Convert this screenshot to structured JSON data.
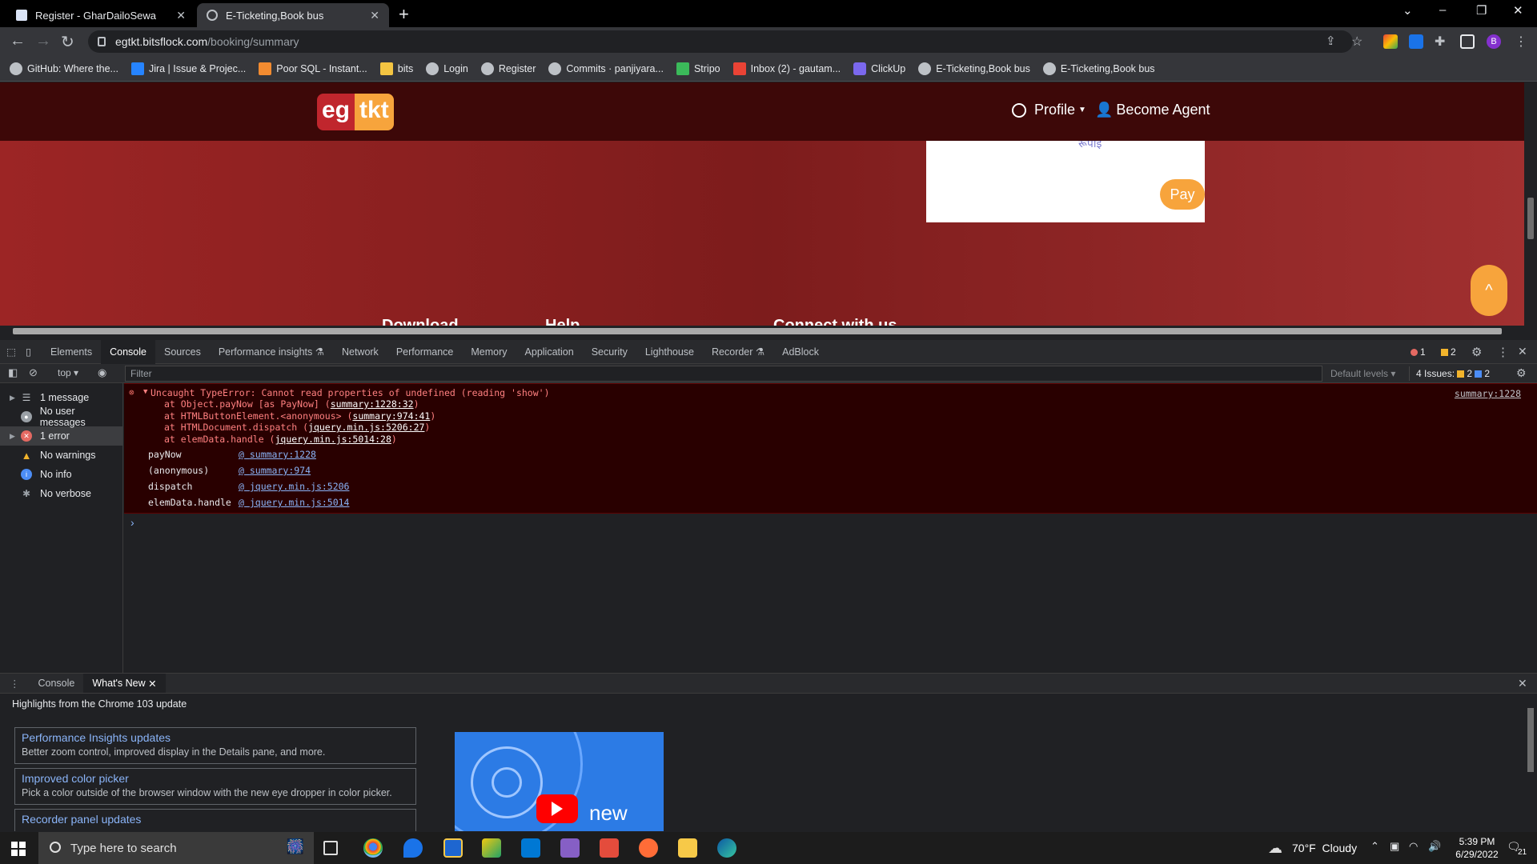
{
  "browser": {
    "tabs": [
      {
        "title": "Register - GharDailoSewa",
        "active": false
      },
      {
        "title": "E-Ticketing,Book bus",
        "active": true
      }
    ],
    "url_host": "egtkt.bitsflock.com",
    "url_path": "/booking/summary",
    "profile_initial": "B",
    "bookmarks": [
      "GitHub: Where the...",
      "Jira | Issue & Projec...",
      "Poor SQL - Instant...",
      "bits",
      "Login",
      "Register",
      "Commits · panjiyara...",
      "Stripo",
      "Inbox (2) - gautam...",
      "ClickUp",
      "E-Ticketing,Book bus",
      "E-Ticketing,Book bus"
    ]
  },
  "site": {
    "logo_a": "eg",
    "logo_b": "tkt",
    "profile_label": "Profile",
    "agent_label": "Become Agent",
    "card_remnant": "रूपाई",
    "pay_label": "Pay",
    "scroll_top": "^",
    "footer": [
      "Download",
      "Help",
      "Connect with us"
    ]
  },
  "devtools": {
    "tabs": [
      "Elements",
      "Console",
      "Sources",
      "Performance insights",
      "Network",
      "Performance",
      "Memory",
      "Application",
      "Security",
      "Lighthouse",
      "Recorder",
      "AdBlock"
    ],
    "active_tab": "Console",
    "error_count": "1",
    "warning_count": "2",
    "context": "top",
    "filter_placeholder": "Filter",
    "default_levels": "Default levels",
    "issues_label": "4 Issues:",
    "issues_warn": "2",
    "issues_info": "2",
    "sidebar": [
      {
        "label": "1 message",
        "icon": "list-icon"
      },
      {
        "label": "No user messages",
        "icon": "user-icon"
      },
      {
        "label": "1 error",
        "icon": "error-icon"
      },
      {
        "label": "No warnings",
        "icon": "warning-icon"
      },
      {
        "label": "No info",
        "icon": "info-icon"
      },
      {
        "label": "No verbose",
        "icon": "bug-icon"
      }
    ],
    "error": {
      "message": "Uncaught TypeError: Cannot read properties of undefined (reading 'show')",
      "source": "summary:1228",
      "stack": [
        {
          "text": "at Object.payNow [as PayNow] (",
          "link": "summary:1228:32",
          "end": ")"
        },
        {
          "text": "at HTMLButtonElement.<anonymous> (",
          "link": "summary:974:41",
          "end": ")"
        },
        {
          "text": "at HTMLDocument.dispatch (",
          "link": "jquery.min.js:5206:27",
          "end": ")"
        },
        {
          "text": "at elemData.handle (",
          "link": "jquery.min.js:5014:28",
          "end": ")"
        }
      ],
      "frames": [
        {
          "fn": "payNow",
          "link": "summary:1228"
        },
        {
          "fn": "(anonymous)",
          "link": "summary:974"
        },
        {
          "fn": "dispatch",
          "link": "jquery.min.js:5206"
        },
        {
          "fn": "elemData.handle",
          "link": "jquery.min.js:5014"
        }
      ]
    },
    "drawer": {
      "tabs": [
        "Console",
        "What's New"
      ],
      "highlight": "Highlights from the Chrome 103 update",
      "cards": [
        {
          "title": "Performance Insights updates",
          "desc": "Better zoom control, improved display in the Details pane, and more."
        },
        {
          "title": "Improved color picker",
          "desc": "Pick a color outside of the browser window with the new eye dropper in color picker."
        },
        {
          "title": "Recorder panel updates",
          "desc": ""
        }
      ],
      "video_text": "new"
    }
  },
  "taskbar": {
    "search_placeholder": "Type here to search",
    "weather": "70°F  Cloudy",
    "time": "5:39 PM",
    "date": "6/29/2022",
    "notifications": "21"
  }
}
